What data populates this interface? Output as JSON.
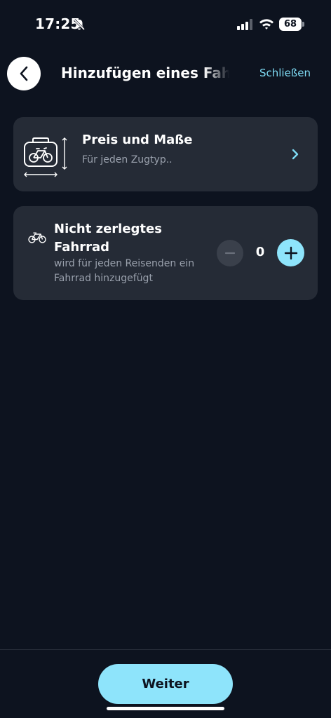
{
  "status_bar": {
    "time": "17:25",
    "battery": "68",
    "icons": [
      "bell-muted-icon",
      "signal-icon",
      "wifi-icon",
      "battery-icon"
    ]
  },
  "header": {
    "title": "Hinzufügen eines Fahrrads",
    "close_label": "Schließen",
    "back_icon": "chevron-left-icon"
  },
  "price_card": {
    "title": "Preis und Maße",
    "subtitle": "Für jeden Zugtyp..",
    "icon": "bike-box-dimensions-icon"
  },
  "bike_option": {
    "title": "Nicht zerlegtes Fahrrad",
    "subtitle": "wird für jeden Reisenden ein Fahrrad hinzugefügt",
    "count": "0",
    "icon": "bicycle-icon"
  },
  "footer": {
    "continue_label": "Weiter"
  },
  "colors": {
    "background": "#0d131f",
    "card": "#252b36",
    "accent": "#8ee4fb",
    "link": "#7fdcf5",
    "muted_text": "#9aa1ad"
  }
}
